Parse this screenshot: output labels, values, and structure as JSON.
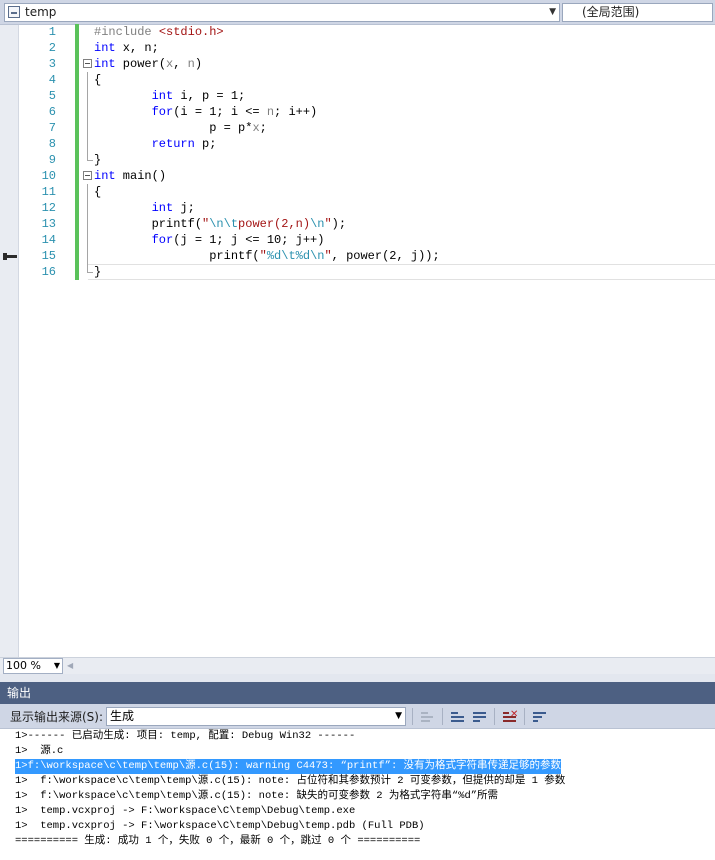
{
  "navbar": {
    "file_scope": "temp",
    "global_scope": "(全局范围)"
  },
  "editor": {
    "lines": [
      {
        "num": "1",
        "code": [
          {
            "t": "#include ",
            "c": "pp"
          },
          {
            "t": "<stdio.h>",
            "c": "st"
          }
        ]
      },
      {
        "num": "2",
        "code": [
          {
            "t": "int",
            "c": "kw"
          },
          {
            "t": " x, n;",
            "c": ""
          }
        ]
      },
      {
        "num": "3",
        "code": [
          {
            "t": "int",
            "c": "kw"
          },
          {
            "t": " power(",
            "c": ""
          },
          {
            "t": "x",
            "c": "idg"
          },
          {
            "t": ", ",
            "c": ""
          },
          {
            "t": "n",
            "c": "idg"
          },
          {
            "t": ")",
            "c": ""
          }
        ]
      },
      {
        "num": "4",
        "code": [
          {
            "t": "{",
            "c": ""
          }
        ]
      },
      {
        "num": "5",
        "code": [
          {
            "t": "        ",
            "c": ""
          },
          {
            "t": "int",
            "c": "kw"
          },
          {
            "t": " i, p = 1;",
            "c": ""
          }
        ]
      },
      {
        "num": "6",
        "code": [
          {
            "t": "        ",
            "c": ""
          },
          {
            "t": "for",
            "c": "kw"
          },
          {
            "t": "(i = 1; i <= ",
            "c": ""
          },
          {
            "t": "n",
            "c": "idg"
          },
          {
            "t": "; i++)",
            "c": ""
          }
        ]
      },
      {
        "num": "7",
        "code": [
          {
            "t": "                p = p*",
            "c": ""
          },
          {
            "t": "x",
            "c": "idg"
          },
          {
            "t": ";",
            "c": ""
          }
        ]
      },
      {
        "num": "8",
        "code": [
          {
            "t": "        ",
            "c": ""
          },
          {
            "t": "return",
            "c": "kw"
          },
          {
            "t": " p;",
            "c": ""
          }
        ]
      },
      {
        "num": "9",
        "code": [
          {
            "t": "}",
            "c": ""
          }
        ]
      },
      {
        "num": "10",
        "code": [
          {
            "t": "int",
            "c": "kw"
          },
          {
            "t": " main()",
            "c": ""
          }
        ]
      },
      {
        "num": "11",
        "code": [
          {
            "t": "{",
            "c": ""
          }
        ]
      },
      {
        "num": "12",
        "code": [
          {
            "t": "        ",
            "c": ""
          },
          {
            "t": "int",
            "c": "kw"
          },
          {
            "t": " j;",
            "c": ""
          }
        ]
      },
      {
        "num": "13",
        "code": [
          {
            "t": "        printf(",
            "c": ""
          },
          {
            "t": "\"",
            "c": "st"
          },
          {
            "t": "\\n\\t",
            "c": "esc"
          },
          {
            "t": "power(2,n)",
            "c": "st"
          },
          {
            "t": "\\n",
            "c": "esc"
          },
          {
            "t": "\"",
            "c": "st"
          },
          {
            "t": ");",
            "c": ""
          }
        ]
      },
      {
        "num": "14",
        "code": [
          {
            "t": "        ",
            "c": ""
          },
          {
            "t": "for",
            "c": "kw"
          },
          {
            "t": "(j = 1; j <= 10; j++)",
            "c": ""
          }
        ]
      },
      {
        "num": "15",
        "code": [
          {
            "t": "                printf(",
            "c": ""
          },
          {
            "t": "\"",
            "c": "st"
          },
          {
            "t": "%d",
            "c": "esc"
          },
          {
            "t": "\\t",
            "c": "esc"
          },
          {
            "t": "%d",
            "c": "esc"
          },
          {
            "t": "\\n",
            "c": "esc"
          },
          {
            "t": "\"",
            "c": "st"
          },
          {
            "t": ", power(2, j));",
            "c": ""
          }
        ]
      },
      {
        "num": "16",
        "code": [
          {
            "t": "}",
            "c": ""
          }
        ]
      }
    ]
  },
  "zoom": {
    "level": "100 %"
  },
  "output": {
    "title": "输出",
    "source_label": "显示输出来源(S):",
    "source_value": "生成",
    "lines": [
      "1>------ 已启动生成: 项目: temp, 配置: Debug Win32 ------",
      "1>  源.c",
      "1>f:\\workspace\\c\\temp\\temp\\源.c(15): warning C4473: “printf”: 没有为格式字符串传递足够的参数",
      "1>  f:\\workspace\\c\\temp\\temp\\源.c(15): note: 占位符和其参数预计 2 可变参数，但提供的却是 1 参数",
      "1>  f:\\workspace\\c\\temp\\temp\\源.c(15): note: 缺失的可变参数 2 为格式字符串“%d”所需",
      "1>  temp.vcxproj -> F:\\workspace\\C\\temp\\Debug\\temp.exe",
      "1>  temp.vcxproj -> F:\\workspace\\C\\temp\\Debug\\temp.pdb (Full PDB)",
      "========== 生成: 成功 1 个，失败 0 个，最新 0 个，跳过 0 个 =========="
    ],
    "selected_line": 2
  },
  "colors": {
    "keyword": "#0000ff",
    "string": "#a31515",
    "line_number": "#2b91af",
    "changed_bar": "#5ac25a",
    "selection": "#3399ff",
    "output_title_bg": "#4d6082"
  }
}
